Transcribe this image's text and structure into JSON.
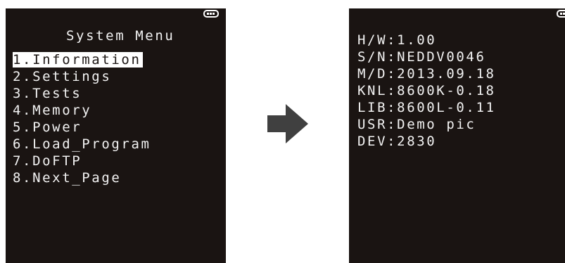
{
  "left_screen": {
    "title": "System Menu",
    "items": [
      {
        "label": "1.Information",
        "selected": true
      },
      {
        "label": "2.Settings",
        "selected": false
      },
      {
        "label": "3.Tests",
        "selected": false
      },
      {
        "label": "4.Memory",
        "selected": false
      },
      {
        "label": "5.Power",
        "selected": false
      },
      {
        "label": "6.Load_Program",
        "selected": false
      },
      {
        "label": "7.DoFTP",
        "selected": false
      },
      {
        "label": "8.Next_Page",
        "selected": false
      }
    ],
    "battery_icon": "battery-full-icon"
  },
  "transition": {
    "icon": "arrow-right-icon",
    "color": "#404040"
  },
  "right_screen": {
    "lines": [
      "H/W:1.00",
      "S/N:NEDDV0046",
      "M/D:2013.09.18",
      "KNL:8600K-0.18",
      "LIB:8600L-0.11",
      "USR:Demo pic",
      "DEV:2830"
    ],
    "battery_icon": "battery-full-icon"
  },
  "colors": {
    "screen_background": "#1a1412",
    "text": "#f2f2f2",
    "highlight_background": "#ffffff"
  }
}
